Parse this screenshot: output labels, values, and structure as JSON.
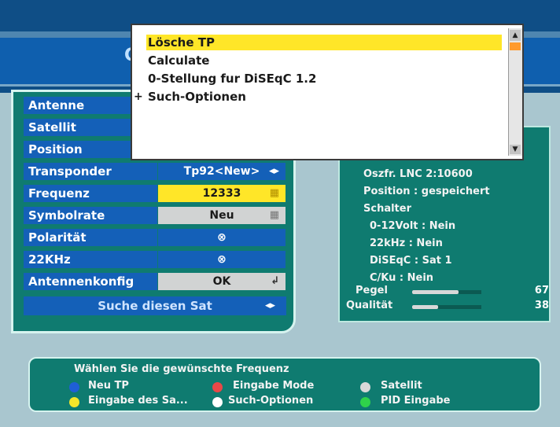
{
  "popup": {
    "items": [
      "Lösche TP",
      "Calculate",
      "0-Stellung fur DiSEqC 1.2",
      "Such-Optionen"
    ],
    "submenu_marker": "+"
  },
  "title_stub": "C",
  "rows": [
    {
      "label": "Antenne"
    },
    {
      "label": "Satellit"
    },
    {
      "label": "Position"
    },
    {
      "label": "Transponder",
      "value": "Tp92<New>",
      "icon": "◂▸"
    },
    {
      "label": "Frequenz",
      "value": "12333",
      "icon": "▦"
    },
    {
      "label": "Symbolrate",
      "value": "Neu",
      "icon": "▦"
    },
    {
      "label": "Polarität",
      "value": "⊗"
    },
    {
      "label": "22KHz",
      "value": "⊗"
    },
    {
      "label": "Antennenkonfig",
      "value": "OK",
      "icon": "↲"
    }
  ],
  "search_sat": {
    "label": "Suche diesen Sat",
    "icon": "◂▸"
  },
  "info": {
    "lnc": "Oszfr. LNC 2:10600",
    "position": "Position : gespeichert",
    "schalter": "Schalter",
    "volt": "0-12Volt : Nein",
    "khz": "22kHz : Nein",
    "diseqc": "DiSEqC : Sat 1",
    "cku": "C/Ku : Nein",
    "pegel_label": "Pegel",
    "pegel_value": 67,
    "qualitaet_label": "Qualität",
    "qualitaet_value": 38
  },
  "help": {
    "title": "Wählen Sie die gewünschte Frequenz",
    "keys": [
      {
        "color": "#1f5fd6",
        "label": "Neu TP"
      },
      {
        "color": "#e94848",
        "label": "Eingabe Mode"
      },
      {
        "color": "#d8d8d8",
        "label": "Satellit"
      },
      {
        "color": "#f5e62a",
        "label": "Eingabe des Sa..."
      },
      {
        "color": "#ffffff",
        "label": "Such-Optionen"
      },
      {
        "color": "#2fd24a",
        "label": "PID Eingabe"
      }
    ]
  },
  "colors": {
    "accent_yellow": "#ffe628",
    "panel_teal": "#0f7b70",
    "label_blue": "#1460b8"
  }
}
